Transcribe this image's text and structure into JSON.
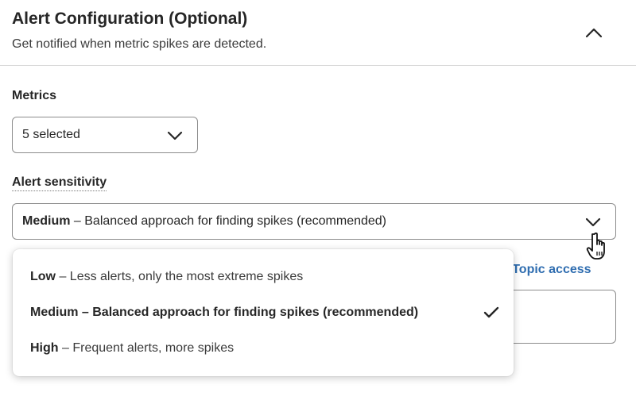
{
  "header": {
    "title": "Alert Configuration (Optional)",
    "subtitle": "Get notified when metric spikes are detected.",
    "collapse_icon": "chevron-up-icon"
  },
  "metrics": {
    "label": "Metrics",
    "selected_value": "5 selected",
    "icon": "chevron-down-icon"
  },
  "sensitivity": {
    "label": "Alert sensitivity",
    "selected_level": "Medium",
    "selected_desc": " – Balanced approach for finding spikes (recommended)",
    "icon": "chevron-down-icon",
    "options": [
      {
        "level": "Low",
        "desc": " – Less alerts, only the most extreme spikes",
        "selected": false
      },
      {
        "level": "Medium",
        "desc": " – Balanced approach for finding spikes (recommended)",
        "selected": true
      },
      {
        "level": "High",
        "desc": " – Frequent alerts, more spikes",
        "selected": false
      }
    ]
  },
  "background": {
    "link_text": "h Topic access"
  },
  "colors": {
    "link": "#2f6db0",
    "border": "#8c8c8c",
    "divider": "#d9d9d9"
  }
}
